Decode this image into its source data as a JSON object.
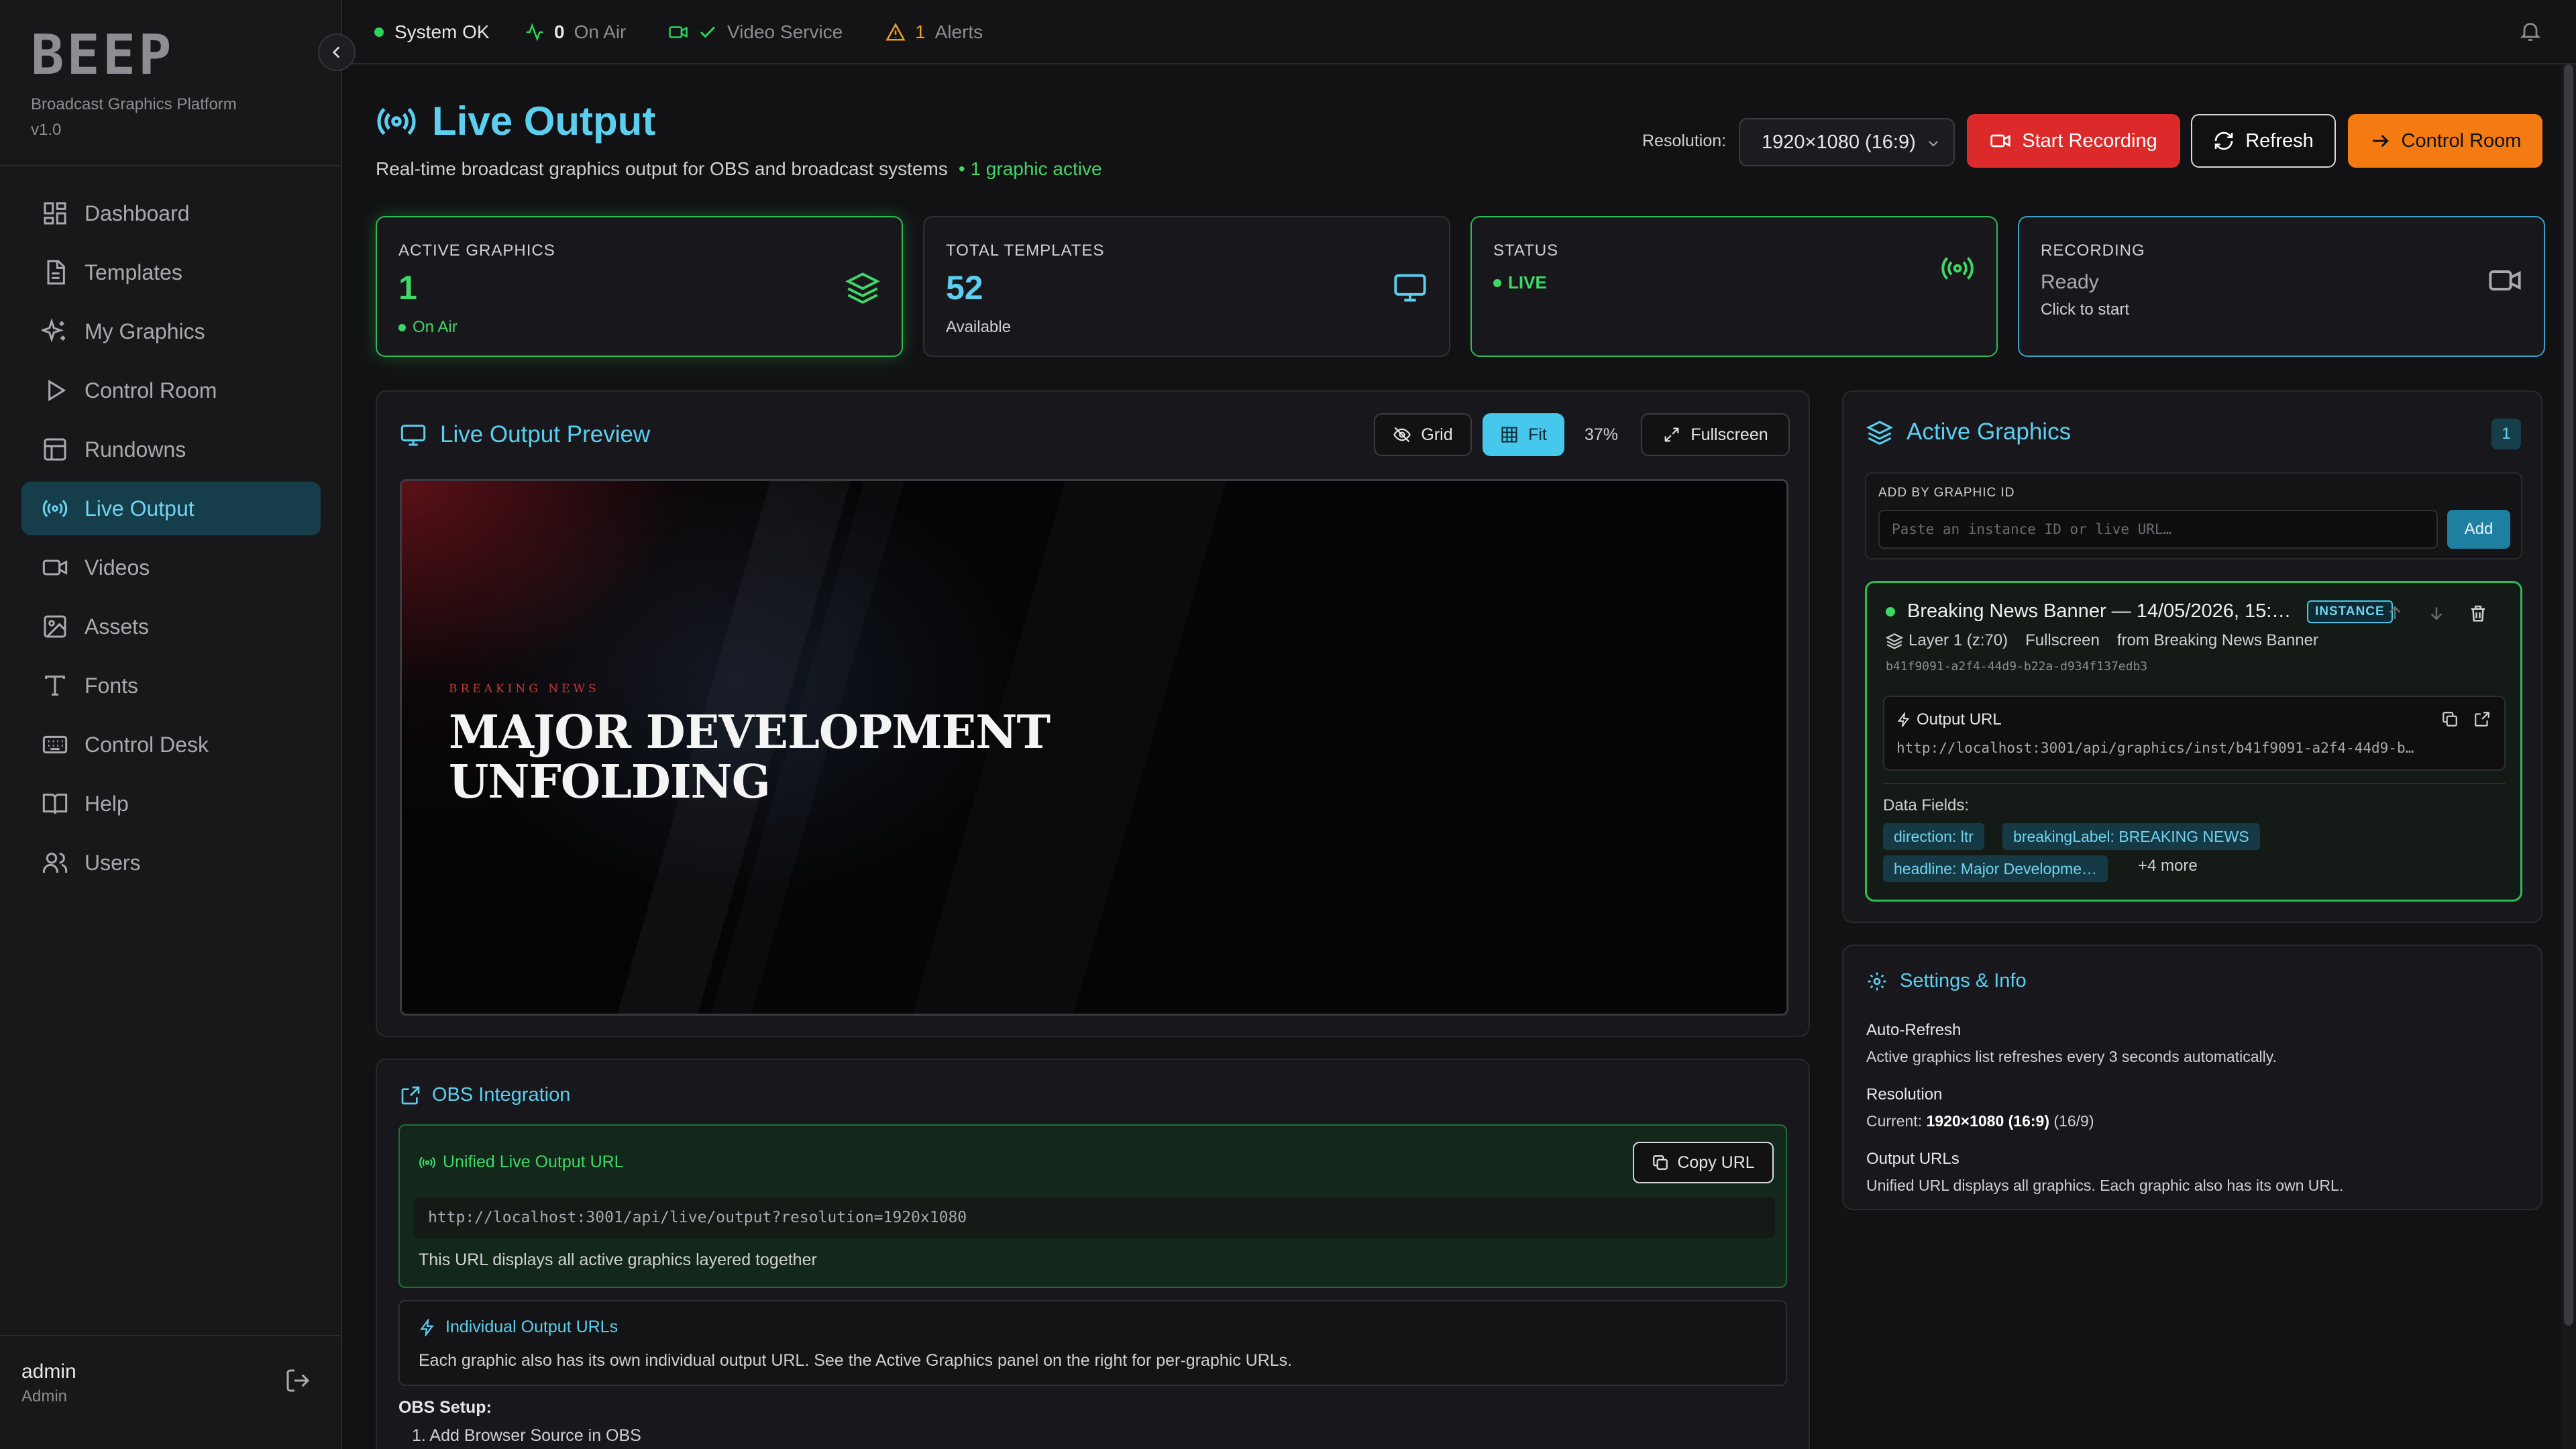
{
  "brand": {
    "logo": "BEEP",
    "subtitle": "Broadcast Graphics Platform",
    "version": "v1.0"
  },
  "nav": [
    {
      "label": "Dashboard",
      "icon": "dashboard-icon"
    },
    {
      "label": "Templates",
      "icon": "document-icon"
    },
    {
      "label": "My Graphics",
      "icon": "sparkles-icon"
    },
    {
      "label": "Control Room",
      "icon": "play-icon"
    },
    {
      "label": "Rundowns",
      "icon": "table-icon"
    },
    {
      "label": "Live Output",
      "icon": "broadcast-icon",
      "active": true
    },
    {
      "label": "Videos",
      "icon": "video-icon"
    },
    {
      "label": "Assets",
      "icon": "image-icon"
    },
    {
      "label": "Fonts",
      "icon": "type-icon"
    },
    {
      "label": "Control Desk",
      "icon": "keyboard-icon"
    },
    {
      "label": "Help",
      "icon": "book-icon"
    },
    {
      "label": "Users",
      "icon": "users-icon"
    }
  ],
  "user": {
    "name": "admin",
    "role": "Admin"
  },
  "topbar": {
    "system": "System OK",
    "on_air_count": "0",
    "on_air_label": "On Air",
    "video_service": "Video Service",
    "alerts_count": "1",
    "alerts_label": "Alerts"
  },
  "header": {
    "title": "Live Output",
    "subtitle": "Real-time broadcast graphics output for OBS and broadcast systems",
    "active_note": "• 1 graphic active",
    "resolution_label": "Resolution:",
    "resolution_value": "1920×1080 (16:9)",
    "start_recording": "Start Recording",
    "refresh": "Refresh",
    "control_room": "Control Room"
  },
  "stats": {
    "active": {
      "caption": "ACTIVE GRAPHICS",
      "value": "1",
      "note": "On Air"
    },
    "templates": {
      "caption": "TOTAL TEMPLATES",
      "value": "52",
      "note": "Available"
    },
    "status": {
      "caption": "STATUS",
      "value": "LIVE"
    },
    "recording": {
      "caption": "RECORDING",
      "value": "Ready",
      "note": "Click to start"
    }
  },
  "preview": {
    "title": "Live Output Preview",
    "grid": "Grid",
    "fit": "Fit",
    "zoom": "37%",
    "fullscreen": "Fullscreen",
    "breaking_label": "BREAKING NEWS",
    "headline": "MAJOR DEVELOPMENT UNFOLDING"
  },
  "obs": {
    "title": "OBS Integration",
    "unified_label": "Unified Live Output URL",
    "copy": "Copy URL",
    "unified_url": "http://localhost:3001/api/live/output?resolution=1920x1080",
    "unified_note": "This URL displays all active graphics layered together",
    "individual_label": "Individual Output URLs",
    "individual_note": "Each graphic also has its own individual output URL. See the Active Graphics panel on the right for per-graphic URLs.",
    "setup": "OBS Setup:",
    "step1": "1. Add Browser Source in OBS"
  },
  "active_graphics": {
    "title": "Active Graphics",
    "count": "1",
    "add_label": "ADD BY GRAPHIC ID",
    "add_placeholder": "Paste an instance ID or live URL…",
    "add_button": "Add",
    "item": {
      "title": "Breaking News Banner — 14/05/2026, 15:…",
      "badge": "INSTANCE",
      "layer": "Layer 1 (z:70)",
      "mode": "Fullscreen",
      "source": "from Breaking News Banner",
      "id": "b41f9091-a2f4-44d9-b22a-d934f137edb3",
      "output_label": "Output URL",
      "output_url": "http://localhost:3001/api/graphics/inst/b41f9091-a2f4-44d9-b…",
      "fields_label": "Data Fields:",
      "fields": [
        "direction: ltr",
        "breakingLabel: BREAKING NEWS",
        "headline: Major Developme…"
      ],
      "more": "+4 more"
    }
  },
  "settings": {
    "title": "Settings & Info",
    "autorefresh_h": "Auto-Refresh",
    "autorefresh_t": "Active graphics list refreshes every 3 seconds automatically.",
    "resolution_h": "Resolution",
    "resolution_prefix": "Current:",
    "resolution_value": "1920×1080 (16:9)",
    "resolution_ratio": "(16/9)",
    "urls_h": "Output URLs",
    "urls_t": "Unified URL displays all graphics. Each graphic also has its own URL."
  },
  "colors": {
    "accent": "#5ccff0",
    "live": "#2bbd55",
    "record": "#dc2a2a",
    "control": "#f47a12"
  }
}
